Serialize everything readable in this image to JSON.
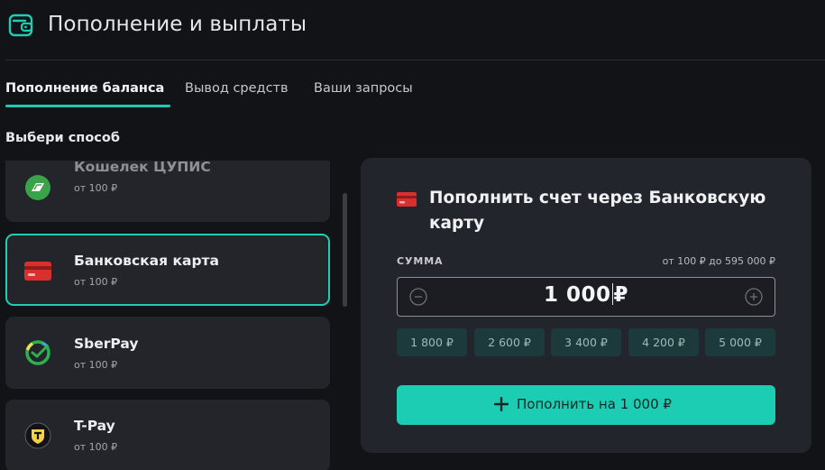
{
  "header": {
    "title": "Пополнение и выплаты",
    "icon": "wallet-icon",
    "accent": "#1fcdb5"
  },
  "tabs": [
    {
      "label": "Пополнение баланса",
      "active": true
    },
    {
      "label": "Вывод средств",
      "active": false
    },
    {
      "label": "Ваши запросы",
      "active": false
    }
  ],
  "methods_section": {
    "label": "Выбери способ",
    "items": [
      {
        "name": "Кошелек ЦУПИС",
        "sub": "от 100 ₽",
        "icon": "cupis-wallet-icon",
        "selected": false
      },
      {
        "name": "Банковская карта",
        "sub": "от 100 ₽",
        "icon": "bank-card-icon",
        "selected": true
      },
      {
        "name": "SberPay",
        "sub": "от 100 ₽",
        "icon": "sberpay-icon",
        "selected": false
      },
      {
        "name": "T-Pay",
        "sub": "от 100 ₽",
        "icon": "tpay-icon",
        "selected": false
      }
    ]
  },
  "deposit_panel": {
    "title": "Пополнить счет через Банковскую карту",
    "icon": "bank-card-icon",
    "sum_label": "СУММА",
    "sum_range": "от 100 ₽ до 595 000 ₽",
    "amount": {
      "digits": "1 000",
      "currency": "₽"
    },
    "presets": [
      "1 800 ₽",
      "2 600 ₽",
      "3 400 ₽",
      "4 200 ₽",
      "5 000 ₽"
    ],
    "submit_label": "Пополнить на 1 000 ₽"
  }
}
